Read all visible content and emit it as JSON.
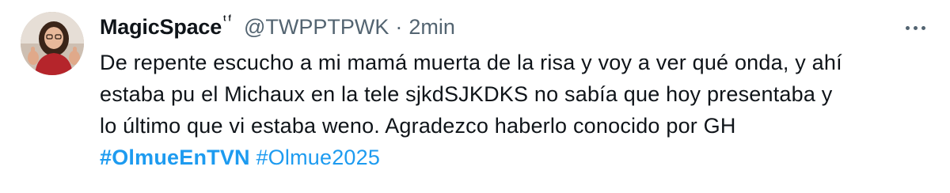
{
  "tweet": {
    "author": {
      "display_name": "MagicSpace",
      "name_suffix": "ᵗᶠ",
      "handle": "@TWPPTPWK",
      "avatar": "profile-photo"
    },
    "separator": "·",
    "timestamp": "2min",
    "more_icon": "more-horizontal-icon",
    "text_lines": [
      "De repente escucho a mi mamá muerta de la risa y voy a ver qué onda, y ahí",
      "estaba pu el Michaux en la tele sjkdSJKDKS no sabía que hoy presentaba y",
      "lo último que vi estaba weno. Agradezco haberlo conocido por GH"
    ],
    "hashtags": [
      "#OlmueEnTVN",
      "#Olmue2025"
    ],
    "colors": {
      "hashtag": "#1d9bf0",
      "text": "#0f1419",
      "secondary": "#536471"
    }
  }
}
